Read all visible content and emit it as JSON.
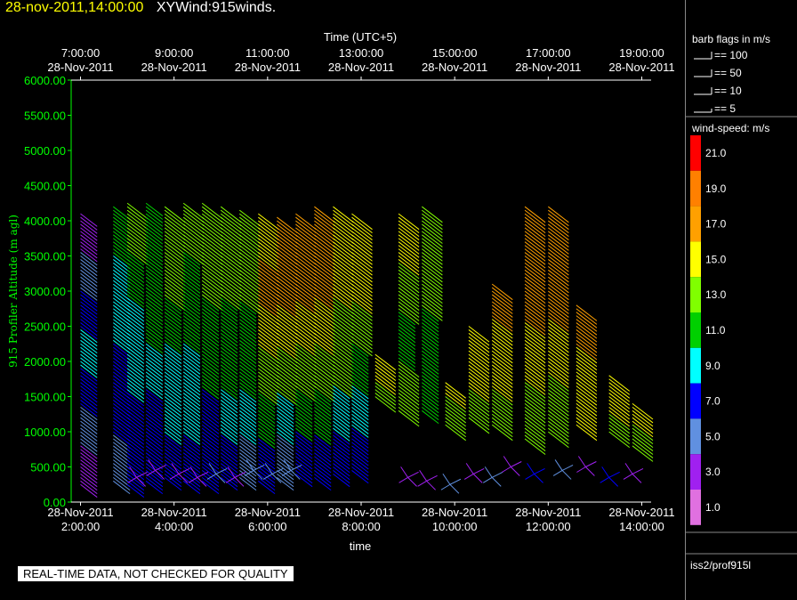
{
  "title": {
    "timestamp": "28-nov-2011,14:00:00",
    "product": "XYWind:915winds."
  },
  "disclaimer": "REAL-TIME DATA, NOT CHECKED FOR QUALITY",
  "source": "iss2/prof915l",
  "barb_legend": {
    "title": "barb flags in m/s",
    "items": [
      "== 100",
      "== 50",
      "== 10",
      "== 5"
    ]
  },
  "colorbar": {
    "title": "wind-speed: m/s",
    "labels": [
      "21.0",
      "19.0",
      "17.0",
      "15.0",
      "13.0",
      "11.0",
      "9.0",
      "7.0",
      "5.0",
      "3.0",
      "1.0"
    ],
    "colors": [
      "#ff0000",
      "#ff8000",
      "#ffa000",
      "#ffff00",
      "#80ff00",
      "#00d000",
      "#00ffff",
      "#0000ff",
      "#6090e0",
      "#a020f0",
      "#e070e0"
    ]
  },
  "colors": {
    "axis_left": "#00ff00",
    "axis_text": "#ffffff",
    "title_time": "#ffff00"
  },
  "chart_data": {
    "type": "wind barb time-height",
    "ylabel": "915 Profiler Altitude (m agl)",
    "xlabel": "time",
    "top_xlabel": "Time (UTC+5)",
    "ylim": [
      0,
      6000
    ],
    "yticks": [
      "0.00",
      "500.00",
      "1000.00",
      "1500.00",
      "2000.00",
      "2500.00",
      "3000.00",
      "3500.00",
      "4000.00",
      "4500.00",
      "5000.00",
      "5500.00",
      "6000.00"
    ],
    "xlim_hours": [
      1.8,
      14.2
    ],
    "bottom_ticks": [
      {
        "hour": 2,
        "date": "28-Nov-2011",
        "time": "2:00:00"
      },
      {
        "hour": 4,
        "date": "28-Nov-2011",
        "time": "4:00:00"
      },
      {
        "hour": 6,
        "date": "28-Nov-2011",
        "time": "6:00:00"
      },
      {
        "hour": 8,
        "date": "28-Nov-2011",
        "time": "8:00:00"
      },
      {
        "hour": 10,
        "date": "28-Nov-2011",
        "time": "10:00:00"
      },
      {
        "hour": 12,
        "date": "28-Nov-2011",
        "time": "12:00:00"
      },
      {
        "hour": 14,
        "date": "28-Nov-2011",
        "time": "14:00:00"
      }
    ],
    "top_ticks": [
      {
        "hour": 2,
        "time": "7:00:00",
        "date": "28-Nov-2011"
      },
      {
        "hour": 4,
        "time": "9:00:00",
        "date": "28-Nov-2011"
      },
      {
        "hour": 6,
        "time": "11:00:00",
        "date": "28-Nov-2011"
      },
      {
        "hour": 8,
        "time": "13:00:00",
        "date": "28-Nov-2011"
      },
      {
        "hour": 10,
        "time": "15:00:00",
        "date": "28-Nov-2011"
      },
      {
        "hour": 12,
        "time": "17:00:00",
        "date": "28-Nov-2011"
      },
      {
        "hour": 14,
        "time": "19:00:00",
        "date": "28-Nov-2011"
      }
    ],
    "profiles": [
      {
        "t": 2.0,
        "top": 4100,
        "low": 250,
        "speeds": [
          3,
          5,
          7,
          9,
          7,
          5,
          3
        ]
      },
      {
        "t": 2.7,
        "top": 4200,
        "low": 300,
        "speeds": [
          11,
          9,
          9,
          7,
          7,
          5
        ]
      },
      {
        "t": 3.0,
        "top": 4250,
        "low": 250,
        "speeds": [
          13,
          11,
          9,
          9,
          7,
          7
        ]
      },
      {
        "t": 3.4,
        "top": 4250,
        "low": 300,
        "speeds": [
          11,
          11,
          11,
          9,
          7,
          7
        ]
      },
      {
        "t": 3.8,
        "top": 4200,
        "low": 350,
        "speeds": [
          13,
          13,
          11,
          9,
          9,
          7
        ]
      },
      {
        "t": 4.2,
        "top": 4250,
        "low": 300,
        "speeds": [
          13,
          11,
          11,
          9,
          9,
          7
        ]
      },
      {
        "t": 4.6,
        "top": 4250,
        "low": 300,
        "speeds": [
          13,
          13,
          11,
          11,
          7,
          7
        ]
      },
      {
        "t": 5.0,
        "top": 4200,
        "low": 350,
        "speeds": [
          13,
          13,
          11,
          11,
          9,
          7
        ]
      },
      {
        "t": 5.4,
        "top": 4150,
        "low": 350,
        "speeds": [
          13,
          13,
          11,
          11,
          9,
          5
        ]
      },
      {
        "t": 5.8,
        "top": 4100,
        "low": 300,
        "speeds": [
          15,
          17,
          15,
          13,
          11,
          7
        ]
      },
      {
        "t": 6.2,
        "top": 4050,
        "low": 350,
        "speeds": [
          17,
          17,
          15,
          13,
          9,
          5
        ]
      },
      {
        "t": 6.6,
        "top": 4100,
        "low": 400,
        "speeds": [
          17,
          17,
          15,
          13,
          11,
          7
        ]
      },
      {
        "t": 7.0,
        "top": 4200,
        "low": 350,
        "speeds": [
          17,
          17,
          15,
          13,
          11,
          7
        ]
      },
      {
        "t": 7.4,
        "top": 4200,
        "low": 400,
        "speeds": [
          15,
          15,
          13,
          13,
          9,
          7
        ]
      },
      {
        "t": 7.8,
        "top": 4100,
        "low": 450,
        "speeds": [
          15,
          15,
          13,
          11,
          9,
          7
        ]
      },
      {
        "t": 8.3,
        "top": 2100,
        "low": 1500,
        "speeds": [
          15,
          15,
          13
        ]
      },
      {
        "t": 8.8,
        "top": 4100,
        "low": 1300,
        "speeds": [
          15,
          13,
          11,
          13
        ]
      },
      {
        "t": 9.3,
        "top": 4200,
        "low": 1300,
        "speeds": [
          13,
          13,
          11,
          11
        ]
      },
      {
        "t": 9.8,
        "top": 1700,
        "low": 1100,
        "speeds": [
          15,
          13,
          13
        ]
      },
      {
        "t": 10.3,
        "top": 2500,
        "low": 1200,
        "speeds": [
          15,
          15,
          13
        ]
      },
      {
        "t": 10.8,
        "top": 3100,
        "low": 1100,
        "speeds": [
          17,
          15,
          15,
          13
        ]
      },
      {
        "t": 11.5,
        "top": 4200,
        "low": 900,
        "speeds": [
          17,
          17,
          15,
          13
        ]
      },
      {
        "t": 12.0,
        "top": 4200,
        "low": 1000,
        "speeds": [
          17,
          17,
          15,
          13
        ]
      },
      {
        "t": 12.6,
        "top": 2800,
        "low": 1100,
        "speeds": [
          17,
          15,
          15
        ]
      },
      {
        "t": 13.3,
        "top": 1800,
        "low": 1000,
        "speeds": [
          15,
          15,
          13
        ]
      },
      {
        "t": 13.8,
        "top": 1400,
        "low": 800,
        "speeds": [
          15,
          13
        ]
      }
    ],
    "low_barbs": [
      {
        "t": 3.2,
        "z": 350,
        "s": 3
      },
      {
        "t": 3.6,
        "z": 450,
        "s": 3
      },
      {
        "t": 4.1,
        "z": 400,
        "s": 3
      },
      {
        "t": 4.5,
        "z": 350,
        "s": 3
      },
      {
        "t": 4.9,
        "z": 400,
        "s": 5
      },
      {
        "t": 5.3,
        "z": 350,
        "s": 3
      },
      {
        "t": 5.7,
        "z": 450,
        "s": 5
      },
      {
        "t": 6.1,
        "z": 400,
        "s": 5
      },
      {
        "t": 6.5,
        "z": 450,
        "s": 5
      },
      {
        "t": 9.0,
        "z": 350,
        "s": 3
      },
      {
        "t": 9.4,
        "z": 300,
        "s": 3
      },
      {
        "t": 9.9,
        "z": 250,
        "s": 5
      },
      {
        "t": 10.4,
        "z": 400,
        "s": 3
      },
      {
        "t": 10.8,
        "z": 350,
        "s": 5
      },
      {
        "t": 11.2,
        "z": 500,
        "s": 3
      },
      {
        "t": 11.7,
        "z": 400,
        "s": 7
      },
      {
        "t": 12.3,
        "z": 450,
        "s": 5
      },
      {
        "t": 12.8,
        "z": 500,
        "s": 3
      },
      {
        "t": 13.3,
        "z": 350,
        "s": 7
      },
      {
        "t": 13.8,
        "z": 400,
        "s": 3
      }
    ]
  }
}
